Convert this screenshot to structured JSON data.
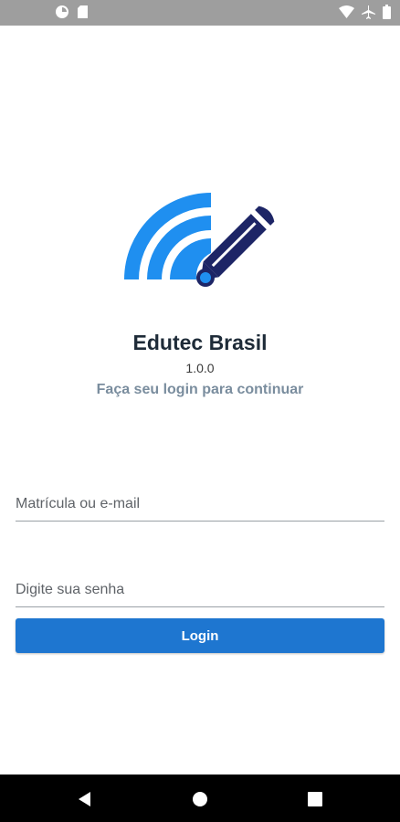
{
  "status_bar": {
    "left_icons": [
      "notification-circle-icon",
      "sd-card-icon"
    ],
    "right_icons": [
      "wifi-icon",
      "airplane-icon",
      "battery-icon"
    ]
  },
  "app": {
    "title": "Edutec Brasil",
    "version": "1.0.0",
    "subtitle": "Faça seu login para continuar"
  },
  "form": {
    "email_placeholder": "Matrícula ou e-mail",
    "email_value": "",
    "password_placeholder": "Digite sua senha",
    "password_value": "",
    "login_label": "Login"
  },
  "nav_bar": {
    "buttons": [
      "back-icon",
      "home-icon",
      "recents-icon"
    ]
  },
  "colors": {
    "accent": "#1e76d0",
    "wifi_blue": "#1f8ff0",
    "pencil": "#1d2566",
    "title": "#1e2b38",
    "subtitle": "#7a8d9e"
  }
}
